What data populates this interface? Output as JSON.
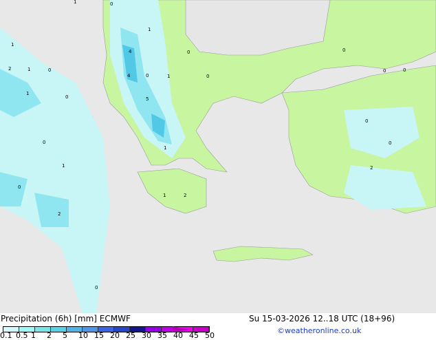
{
  "title": "Precipitation (6h) [mm] ECMWF",
  "datetime": "Su 15-03-2026 12..18 UTC (18+96)",
  "credit": "©weatheronline.co.uk",
  "legend": {
    "ticks": [
      "0.1",
      "0.5",
      "1",
      "2",
      "5",
      "10",
      "15",
      "20",
      "25",
      "30",
      "35",
      "40",
      "45",
      "50"
    ],
    "colors": [
      "#d2fafa",
      "#a0f5f5",
      "#78e6e6",
      "#5ad2e6",
      "#50b4e6",
      "#5096e6",
      "#3c64e6",
      "#2846c8",
      "#14148c",
      "#9600e6",
      "#be00e6",
      "#f000f0",
      "#c800c8"
    ]
  },
  "colors": {
    "sea": "#e8e8e8",
    "land": "#c8f5a0",
    "precip_light": "#c8f5f5",
    "precip_mid": "#90e6f0",
    "precip_heavy": "#50c8e6"
  },
  "map_labels": [
    "1",
    "0",
    "1",
    "2",
    "4",
    "1",
    "0",
    "4",
    "0",
    "1",
    "0",
    "1",
    "5",
    "0",
    "1",
    "0",
    "1",
    "2",
    "0",
    "2",
    "0",
    "1",
    "1",
    "2",
    "0",
    "0",
    "0",
    "0",
    "0",
    "0"
  ]
}
